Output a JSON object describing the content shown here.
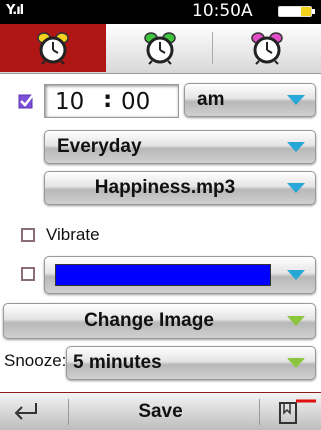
{
  "status": {
    "clock": "10:50A",
    "signal_glyph": "Y.ıl",
    "battery_icon": "battery-icon"
  },
  "tabs": [
    {
      "icon": "alarm-clock-icon",
      "color": "#f5d21e",
      "active": true
    },
    {
      "icon": "alarm-clock-icon",
      "color": "#3ec43e",
      "active": false
    },
    {
      "icon": "alarm-clock-icon",
      "color": "#e24dc8",
      "active": false
    }
  ],
  "alarm": {
    "enabled": true,
    "hour": "10",
    "separator": ":",
    "minute": "00",
    "ampm": "am"
  },
  "repeat": {
    "value": "Everyday"
  },
  "sound": {
    "value": "Happiness.mp3"
  },
  "vibrate": {
    "label": "Vibrate",
    "checked": false
  },
  "color_option": {
    "checked": false,
    "swatch_color": "#0000ff"
  },
  "change_image": {
    "label": "Change Image"
  },
  "snooze": {
    "label": "Snooze:",
    "value": "5 minutes"
  },
  "bottom": {
    "save_label": "Save",
    "back_icon": "back-icon",
    "bookmark_icon": "bookmark-icon"
  },
  "colors": {
    "accent": "#b01616",
    "dropdown_arrow": "#29a8d8",
    "action_arrow": "#8cc63f",
    "checkbox": "#7b4fd6"
  }
}
